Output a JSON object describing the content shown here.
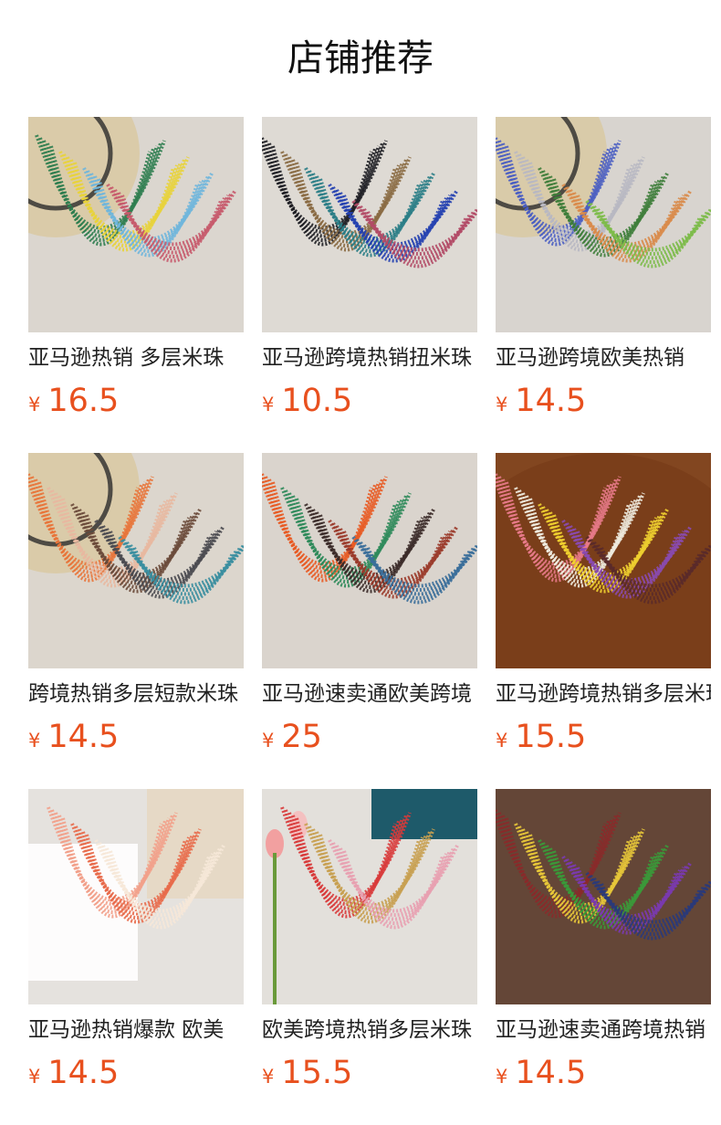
{
  "page": {
    "title": "店铺推荐"
  },
  "products": [
    {
      "name": "亚马逊热销 多层米珠",
      "currency": "¥",
      "price": "16.5",
      "image": "layered-seed-bead-necklaces-straw-hat",
      "colors": [
        "#2e7d4f",
        "#e8d33a",
        "#6fb6dc",
        "#c75a6b"
      ]
    },
    {
      "name": "亚马逊跨境热销扭米珠",
      "currency": "¥",
      "price": "10.5",
      "image": "twisted-seed-bead-necklaces",
      "colors": [
        "#1e1e24",
        "#8a6a42",
        "#2a7d86",
        "#2340b0",
        "#b24b67"
      ]
    },
    {
      "name": "亚马逊跨境欧美热销",
      "currency": "¥",
      "price": "14.5",
      "image": "beaded-necklaces-with-stones",
      "colors": [
        "#4a5ec2",
        "#b8b8c2",
        "#3e7d3a",
        "#d98b4a",
        "#7dbb4a"
      ]
    },
    {
      "name": "跨境热销多层短款米珠",
      "currency": "¥",
      "price": "14.5",
      "image": "short-layered-seed-bead-necklaces",
      "colors": [
        "#e8743a",
        "#e8b8a0",
        "#6a4a3a",
        "#4a4a50",
        "#3a8ea0"
      ]
    },
    {
      "name": "亚马逊速卖通欧美跨境",
      "currency": "¥",
      "price": "25",
      "image": "bib-seed-bead-necklaces-collage",
      "colors": [
        "#e85a22",
        "#2e8a5a",
        "#3a2a28",
        "#9a3a2a",
        "#3a6e9a"
      ]
    },
    {
      "name": "亚马逊跨境热销多层米珠",
      "currency": "¥",
      "price": "15.5",
      "image": "multicolor-seed-bead-necklaces-table",
      "colors": [
        "#e87a8a",
        "#f0ece0",
        "#f0d030",
        "#8a4ab0",
        "#5a2a2a"
      ]
    },
    {
      "name": "亚马逊热销爆款 欧美",
      "currency": "¥",
      "price": "14.5",
      "image": "coral-layered-necklace-with-beads",
      "colors": [
        "#f2a08a",
        "#e86a4a",
        "#f6e8d8"
      ]
    },
    {
      "name": "欧美跨境热销多层米珠",
      "currency": "¥",
      "price": "15.5",
      "image": "red-gold-layered-necklace-tulips",
      "colors": [
        "#d83a3a",
        "#c8a050",
        "#e8a0b0"
      ]
    },
    {
      "name": "亚马逊速卖通跨境热销",
      "currency": "¥",
      "price": "14.5",
      "image": "tassel-seed-bead-necklaces-collage",
      "colors": [
        "#8a2a2a",
        "#e8c83a",
        "#3a9a3a",
        "#7a3ab0",
        "#2a3a7a"
      ]
    }
  ]
}
